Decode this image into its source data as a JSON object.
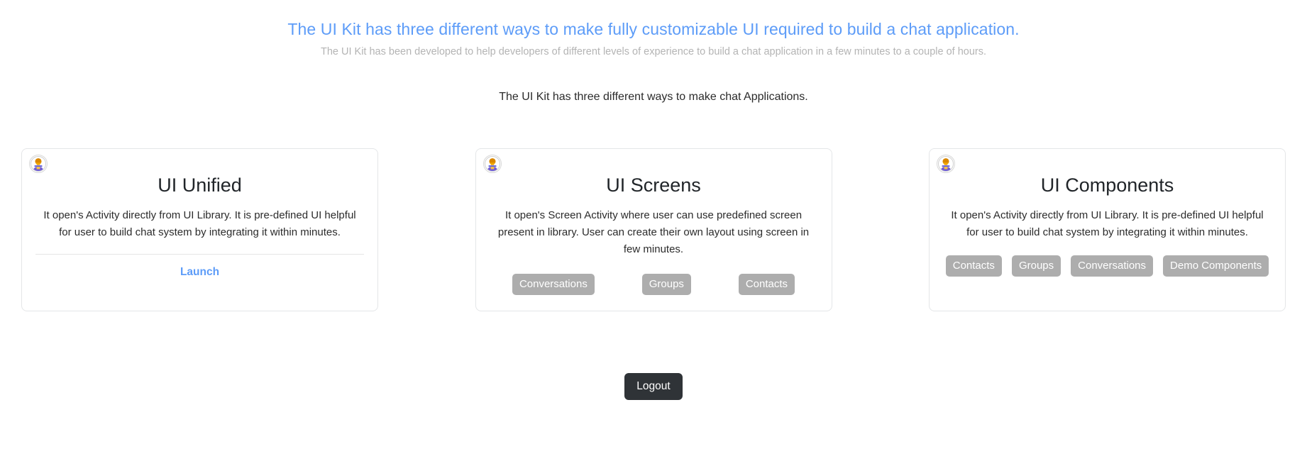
{
  "hero": {
    "title": "The UI Kit has three different ways to make fully customizable UI required to build a chat application.",
    "subtitle": "The UI Kit has been developed to help developers of different levels of experience to build a chat application in a few minutes to a couple of hours.",
    "title_color": "#5d9cf8",
    "subtitle_color": "#b4b4b4"
  },
  "section": {
    "intro": "The UI Kit has three different ways to make chat Applications."
  },
  "cards": [
    {
      "icon": "user-avatar-icon",
      "title": "UI Unified",
      "description": "It open's Activity directly from UI Library. It is pre-defined UI helpful for user to build chat system by integrating it within minutes.",
      "has_divider": true,
      "link_label": "Launch",
      "buttons": []
    },
    {
      "icon": "user-avatar-icon",
      "title": "UI Screens",
      "description": "It open's Screen Activity where user can use predefined screen present in library. User can create their own layout using screen in few minutes.",
      "has_divider": false,
      "link_label": "",
      "buttons": [
        "Conversations",
        "Groups",
        "Contacts"
      ]
    },
    {
      "icon": "user-avatar-icon",
      "title": "UI Components",
      "description": "It open's Activity directly from UI Library. It is pre-defined UI helpful for user to build chat system by integrating it within minutes.",
      "has_divider": false,
      "link_label": "",
      "buttons": [
        "Contacts",
        "Groups",
        "Conversations",
        "Demo Components"
      ]
    }
  ],
  "footer": {
    "logout_label": "Logout",
    "logout_bg": "#2f3337"
  },
  "colors": {
    "accent_blue": "#5d9cf8",
    "button_gray": "#adadad",
    "card_border": "#e4e6e8",
    "body_text": "#2b2b2b"
  }
}
